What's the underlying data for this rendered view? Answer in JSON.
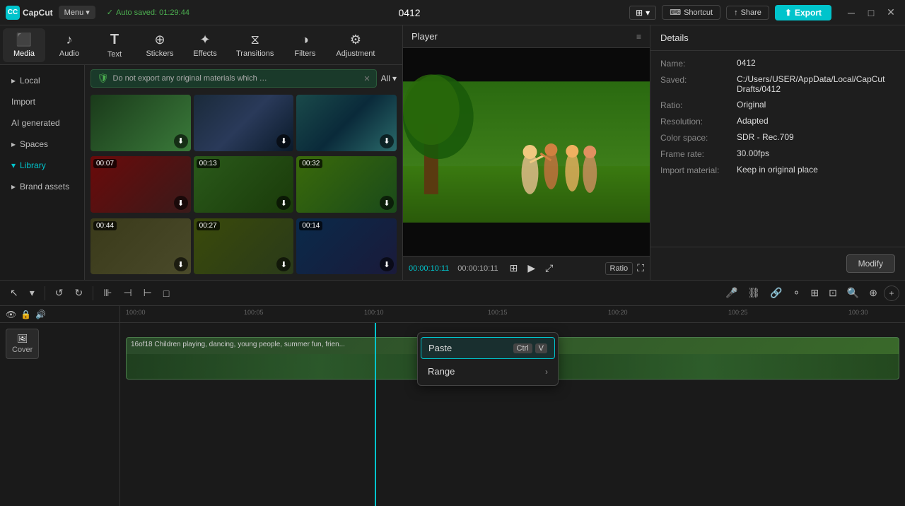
{
  "topbar": {
    "logo_text": "CapCut",
    "menu_label": "Menu ▾",
    "auto_saved": "Auto saved: 01:29:44",
    "project_name": "0412",
    "shortcut_label": "Shortcut",
    "share_label": "Share",
    "export_label": "Export"
  },
  "tabs": [
    {
      "id": "media",
      "label": "Media",
      "icon": "🎬",
      "active": true
    },
    {
      "id": "audio",
      "label": "Audio",
      "icon": "🎵",
      "active": false
    },
    {
      "id": "text",
      "label": "Text",
      "icon": "T",
      "active": false
    },
    {
      "id": "stickers",
      "label": "Stickers",
      "icon": "⭐",
      "active": false
    },
    {
      "id": "effects",
      "label": "Effects",
      "icon": "✨",
      "active": false
    },
    {
      "id": "transitions",
      "label": "Transitions",
      "icon": "⧖",
      "active": false
    },
    {
      "id": "filters",
      "label": "Filters",
      "icon": "🎨",
      "active": false
    },
    {
      "id": "adjustment",
      "label": "Adjustment",
      "icon": "⚙",
      "active": false
    }
  ],
  "sidebar": {
    "items": [
      {
        "id": "local",
        "label": "Local",
        "arrow": "▸",
        "active": false
      },
      {
        "id": "import",
        "label": "Import",
        "arrow": "",
        "active": false
      },
      {
        "id": "ai_generated",
        "label": "AI generated",
        "arrow": "",
        "active": false
      },
      {
        "id": "spaces",
        "label": "Spaces",
        "arrow": "▸",
        "active": false
      },
      {
        "id": "library",
        "label": "Library",
        "arrow": "▸",
        "active": true
      },
      {
        "id": "brand_assets",
        "label": "Brand assets",
        "arrow": "▸",
        "active": false
      }
    ]
  },
  "media_toolbar": {
    "notice": "Do not export any original materials which are not editi...",
    "all_label": "All"
  },
  "media_items": [
    {
      "id": 1,
      "duration": "",
      "class": "thumb-1"
    },
    {
      "id": 2,
      "duration": "",
      "class": "thumb-2"
    },
    {
      "id": 3,
      "duration": "",
      "class": "thumb-3"
    },
    {
      "id": 4,
      "duration": "00:07",
      "class": "thumb-4"
    },
    {
      "id": 5,
      "duration": "00:13",
      "class": "thumb-5"
    },
    {
      "id": 6,
      "duration": "00:32",
      "class": "thumb-6"
    },
    {
      "id": 7,
      "duration": "00:44",
      "class": "thumb-7"
    },
    {
      "id": 8,
      "duration": "00:27",
      "class": "thumb-8"
    },
    {
      "id": 9,
      "duration": "00:14",
      "class": "thumb-9"
    }
  ],
  "player": {
    "title": "Player",
    "current_time": "00:00:10:11",
    "total_time": "00:00:10:11",
    "ratio_label": "Ratio"
  },
  "details": {
    "title": "Details",
    "name_label": "Name:",
    "name_value": "0412",
    "saved_label": "Saved:",
    "saved_value": "C:/Users/USER/AppData/Local/CapCut Drafts/0412",
    "ratio_label": "Ratio:",
    "ratio_value": "Original",
    "resolution_label": "Resolution:",
    "resolution_value": "Adapted",
    "color_space_label": "Color space:",
    "color_space_value": "SDR - Rec.709",
    "frame_rate_label": "Frame rate:",
    "frame_rate_value": "30.00fps",
    "import_material_label": "Import material:",
    "import_material_value": "Keep in original place",
    "modify_label": "Modify"
  },
  "timeline": {
    "rulers": [
      "100:00",
      "100:05",
      "100:10",
      "100:15",
      "100:20",
      "100:25",
      "100:30"
    ],
    "clip_label": "16of18 Children playing, dancing, young people, summer fun, frien...",
    "cover_label": "Cover"
  },
  "context_menu": {
    "paste_label": "Paste",
    "paste_key1": "Ctrl",
    "paste_key2": "V",
    "range_label": "Range",
    "highlighted_item": "paste"
  }
}
